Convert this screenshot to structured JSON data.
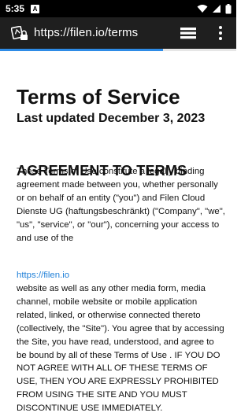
{
  "status_bar": {
    "time": "5:35",
    "notification_letter": "A"
  },
  "toolbar": {
    "url": "https://filen.io/terms",
    "site_icon": "site-settings-icon",
    "tabs_icon": "tabs-icon",
    "menu_icon": "more-vert-icon"
  },
  "load_progress": 0.69,
  "page": {
    "title": "Terms of Service",
    "last_updated": "Last updated December 3, 2023",
    "section_heading": "AGREEMENT TO TERMS",
    "paragraph_part1": "These Terms of Use constitute a legally binding agreement made between you, whether personally or on behalf of an entity (\"you\") and Filen Cloud Dienste UG (haftungsbeschränkt) (\"Company\", \"we\", \"us\", \"service\", or \"our\"), concerning your access to and use of the",
    "link_text": "https://filen.io",
    "paragraph_part2": "website as well as any other media form, media channel, mobile website or mobile application related, linked, or otherwise connected thereto (collectively, the \"Site\"). You agree that by accessing the Site, you have read, understood, and agree to be bound by all of these Terms of Use . IF YOU DO NOT AGREE WITH ALL OF THESE TERMS OF USE, THEN YOU ARE EXPRESSLY PROHIBITED FROM USING THE SITE AND YOU MUST DISCONTINUE USE IMMEDIATELY."
  },
  "colors": {
    "toolbar_bg": "#1f1f1f",
    "progress": "#2e8be6",
    "link": "#1e7fd8"
  }
}
